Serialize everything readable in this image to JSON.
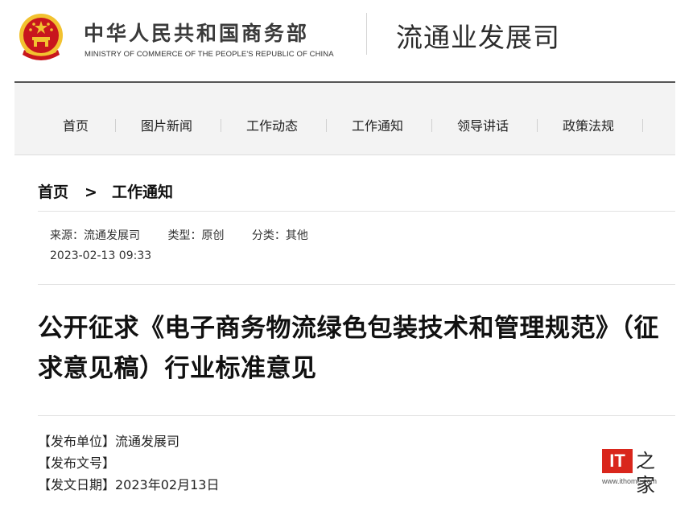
{
  "header": {
    "ministry_name": "中华人民共和国商务部",
    "ministry_name_en": "MINISTRY OF COMMERCE OF THE PEOPLE'S REPUBLIC OF CHINA",
    "department_name": "流通业发展司",
    "emblem_icon": "national-emblem-icon",
    "colors": {
      "emblem_red": "#c8161d",
      "emblem_gold": "#f2c230"
    }
  },
  "nav": {
    "items": [
      {
        "label": "首页"
      },
      {
        "label": "图片新闻"
      },
      {
        "label": "工作动态"
      },
      {
        "label": "工作通知"
      },
      {
        "label": "领导讲话"
      },
      {
        "label": "政策法规"
      }
    ]
  },
  "breadcrumb": {
    "home": "首页",
    "separator": ">",
    "current": "工作通知"
  },
  "meta": {
    "source": "来源：流通发展司",
    "type": "类型：原创",
    "category": "分类：其他",
    "datetime": "2023-02-13 09:33"
  },
  "article": {
    "title": "公开征求《电子商务物流绿色包装技术和管理规范》（征求意见稿）行业标准意见",
    "publisher": "【发布单位】流通发展司",
    "doc_number": "【发布文号】",
    "issue_date": "【发文日期】2023年02月13日"
  },
  "watermark": {
    "logo_text": "IT",
    "glyph": "之家",
    "url": "www.ithome.com",
    "color": "#d9261c"
  }
}
